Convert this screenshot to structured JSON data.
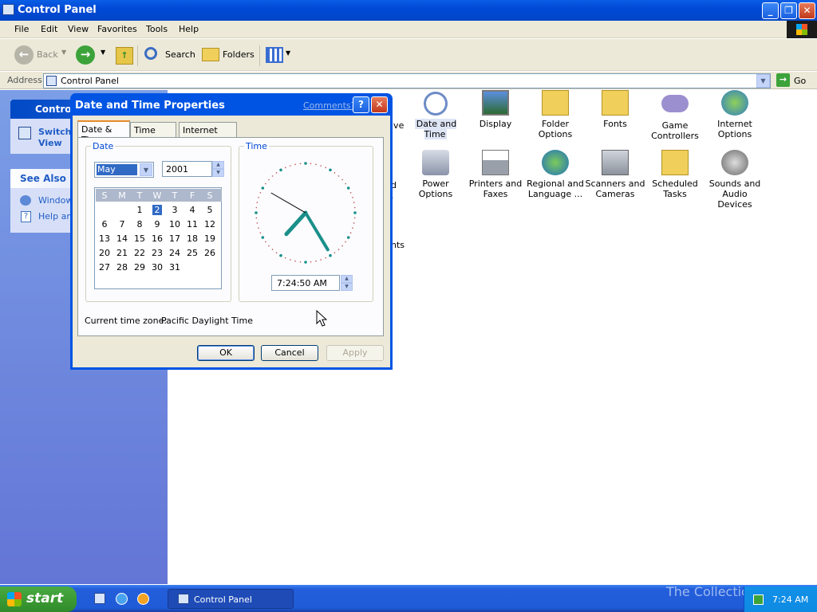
{
  "window": {
    "title": "Control Panel"
  },
  "menu": [
    "File",
    "Edit",
    "View",
    "Favorites",
    "Tools",
    "Help"
  ],
  "toolbar": {
    "back": "Back",
    "search": "Search",
    "folders": "Folders"
  },
  "address": {
    "label": "Address",
    "value": "Control Panel",
    "go": "Go"
  },
  "taskpane": {
    "control_title": "Control",
    "switch_line1": "Switch",
    "switch_line2": "View",
    "see_also": "See Also",
    "link1": "Windows",
    "link2": "Help and"
  },
  "items": [
    {
      "label": "ive",
      "partial": true
    },
    {
      "label": "Date and Time"
    },
    {
      "label": "Display"
    },
    {
      "label": "Folder Options"
    },
    {
      "label": "Fonts"
    },
    {
      "label": "Game Controllers"
    },
    {
      "label": "Internet Options"
    },
    {
      "label": "d ."
    },
    {
      "label": "Power Options"
    },
    {
      "label": "Printers and Faxes"
    },
    {
      "label": "Regional and Language ..."
    },
    {
      "label": "Scanners and Cameras"
    },
    {
      "label": "Scheduled Tasks"
    },
    {
      "label": "Sounds and Audio Devices"
    },
    {
      "label": "nts"
    }
  ],
  "dialog": {
    "title": "Date and Time Properties",
    "comments": "Comments?",
    "help": "?",
    "tabs": [
      "Date & Time",
      "Time Zone",
      "Internet Time"
    ],
    "date_label": "Date",
    "time_label": "Time",
    "month": "May",
    "year": "2001",
    "weekdays": [
      "S",
      "M",
      "T",
      "W",
      "T",
      "F",
      "S"
    ],
    "selected_day": "2",
    "time": "7:24:50 AM",
    "clock": {
      "hour": 7,
      "minute": 24,
      "second": 50
    },
    "timezone_label": "Current time zone:",
    "timezone": "Pacific Daylight Time",
    "ok": "OK",
    "cancel": "Cancel",
    "apply": "Apply"
  },
  "taskbar": {
    "start": "start",
    "task": "Control Panel",
    "clock": "7:24 AM",
    "watermark": "The Collection Book"
  },
  "colors": {
    "accent": "#0054e3",
    "taskbar": "#245edb",
    "start": "#3c9b34"
  }
}
